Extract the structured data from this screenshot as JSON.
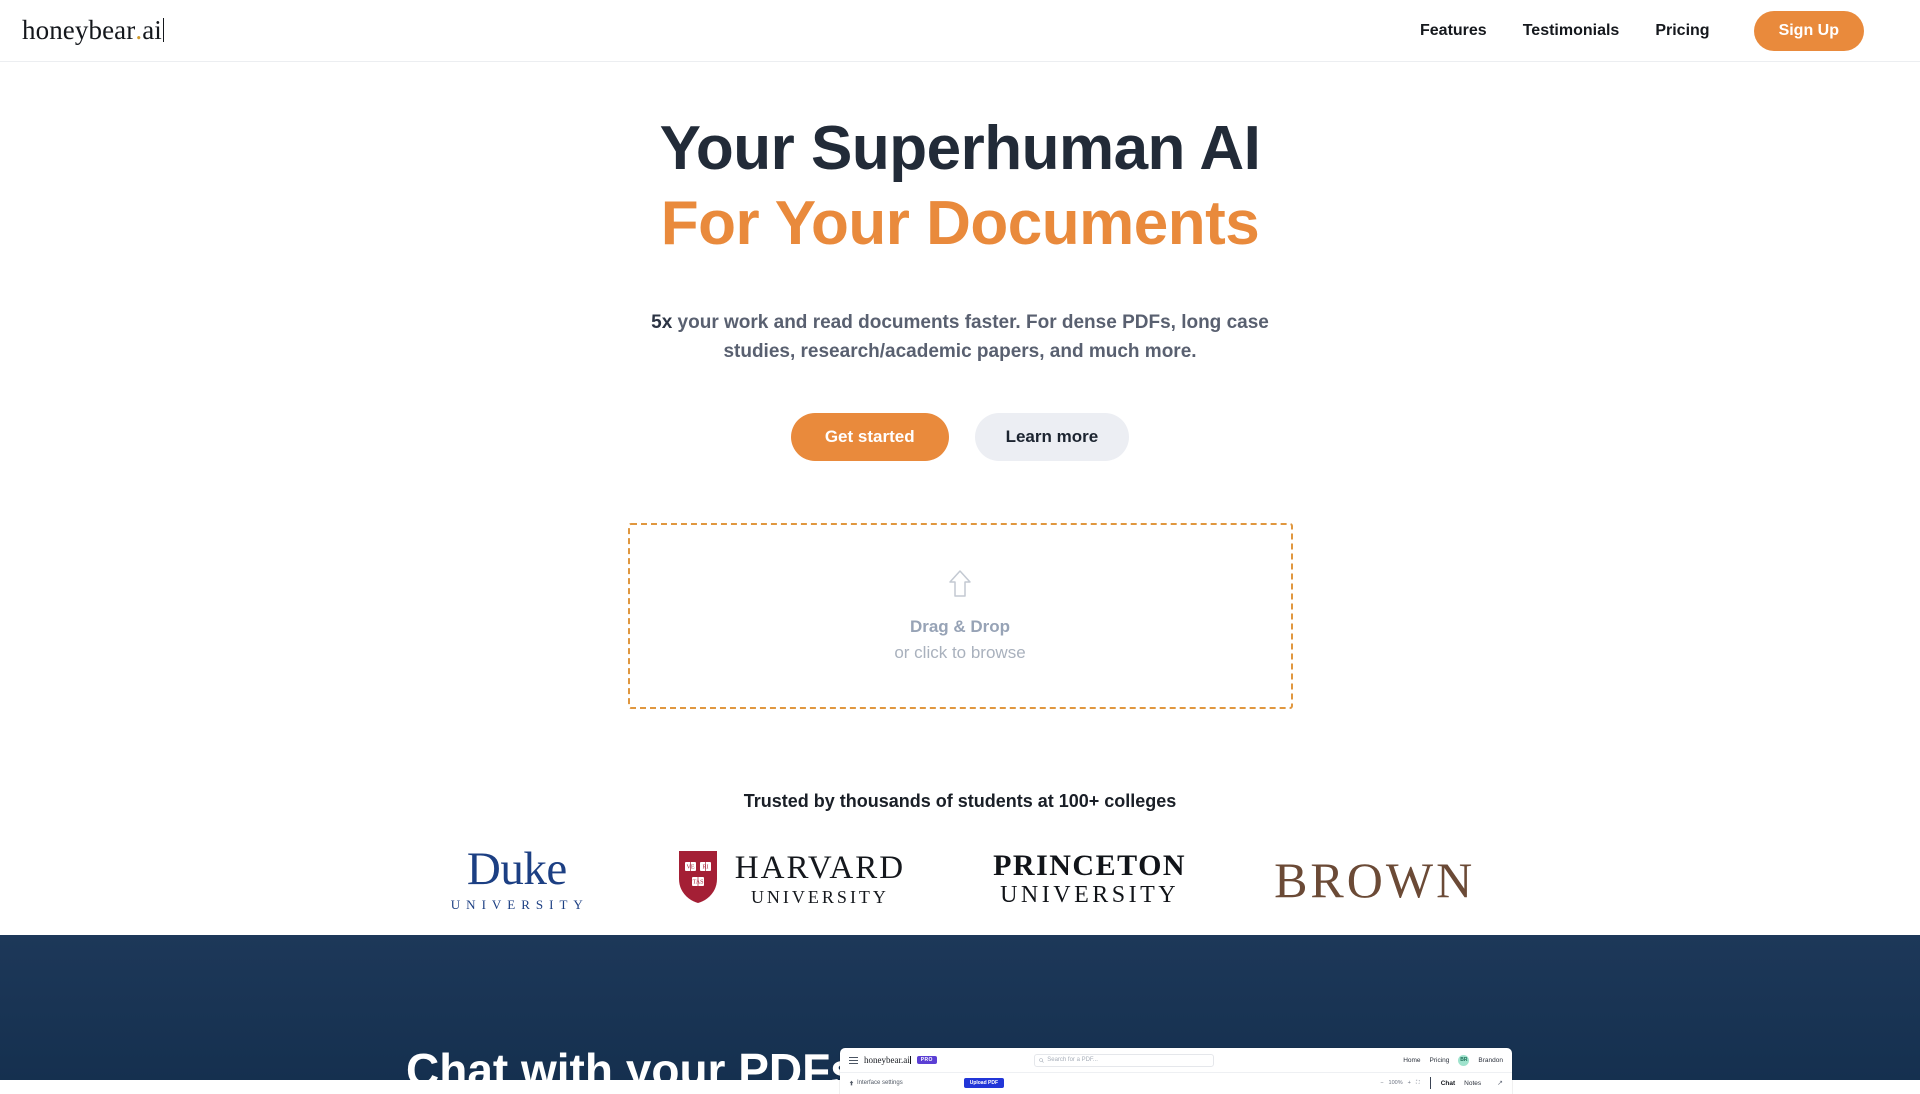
{
  "navbar": {
    "logo": {
      "name": "honeybear",
      "dot": ".",
      "suffix": "ai"
    },
    "links": [
      {
        "label": "Features"
      },
      {
        "label": "Testimonials"
      },
      {
        "label": "Pricing"
      }
    ],
    "signup_label": "Sign Up"
  },
  "hero": {
    "headline_line1": "Your Superhuman AI",
    "headline_line2": "For Your Documents",
    "subhead_strong": "5x",
    "subhead_rest": " your work and read documents faster. For dense PDFs, long case studies, research/academic papers, and much more.",
    "cta_primary": "Get started",
    "cta_secondary": "Learn more"
  },
  "dropzone": {
    "title": "Drag & Drop",
    "subtitle": "or click to browse",
    "icon": "upload-arrow-icon"
  },
  "trust": {
    "heading": "Trusted by thousands of students at 100+ colleges",
    "logos": [
      {
        "name": "Duke",
        "sub": "UNIVERSITY"
      },
      {
        "name": "HARVARD",
        "sub": "UNIVERSITY",
        "shield_text": [
          "VE",
          "RI",
          "TAS"
        ]
      },
      {
        "name": "PRINCETON",
        "sub": "UNIVERSITY"
      },
      {
        "name": "BROWN",
        "sub": ""
      }
    ]
  },
  "dark_section": {
    "heading": "Chat with your PDFs"
  },
  "app_preview": {
    "logo": "honeybear.ai",
    "pro_badge": "PRO",
    "search_placeholder": "Search for a PDF...",
    "nav": [
      {
        "label": "Home"
      },
      {
        "label": "Pricing"
      }
    ],
    "avatar_initials": "BR",
    "username": "Brandon",
    "sidebar_label": "Interface settings",
    "upload_label": "Upload PDF",
    "zoom_level": "100%",
    "tabs": [
      {
        "label": "Chat",
        "active": true
      },
      {
        "label": "Notes",
        "active": false
      }
    ]
  },
  "colors": {
    "accent_orange": "#e98a3c",
    "headline_dark": "#222b38",
    "dark_navy": "#1d3859",
    "duke_blue": "#1c3f83",
    "harvard_crimson": "#a41f35",
    "brown_brown": "#6b4a36",
    "pro_purple": "#5b3fd4",
    "upload_blue": "#2236d8"
  }
}
